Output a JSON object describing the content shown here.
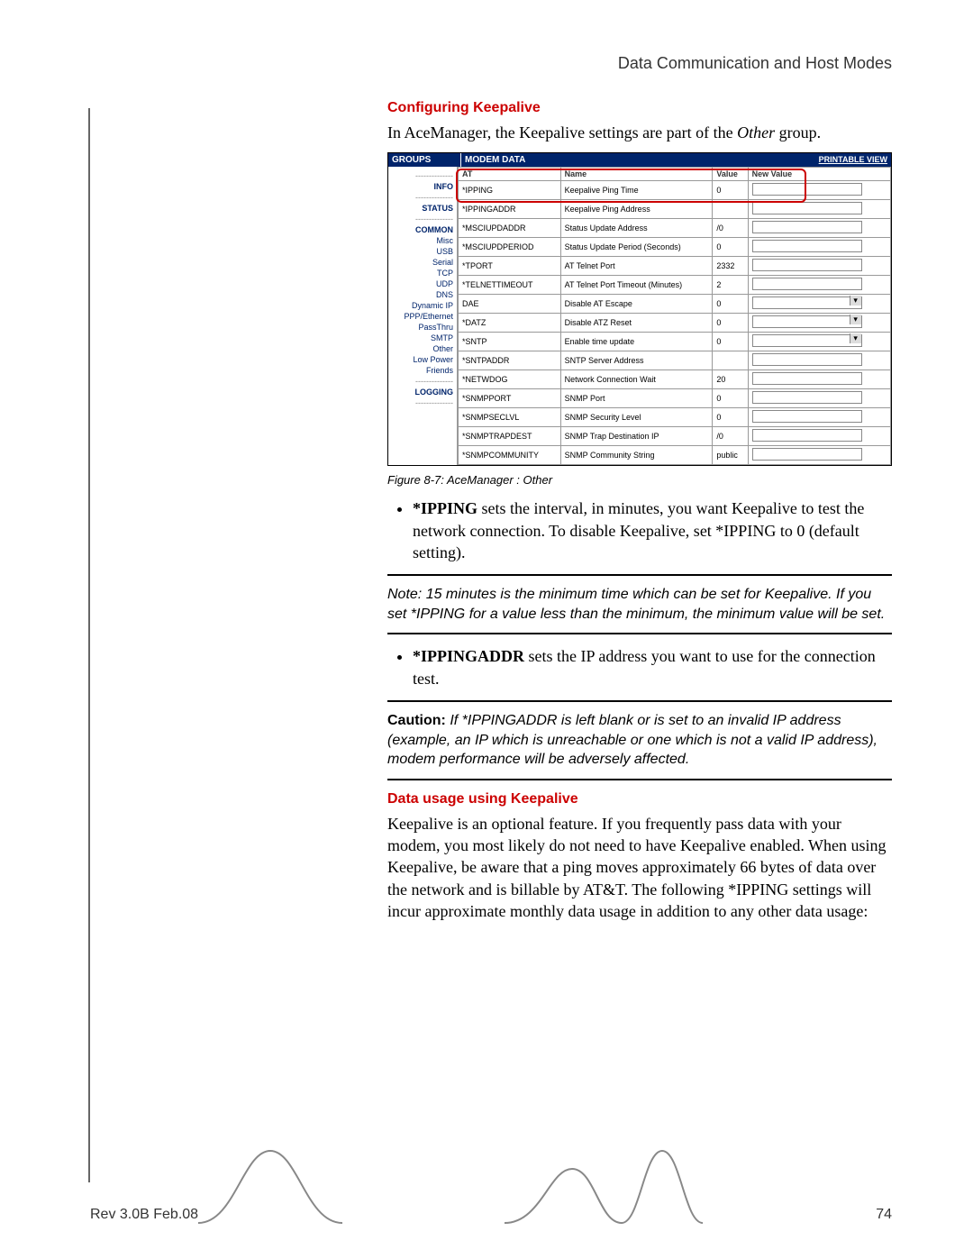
{
  "header": {
    "title": "Data Communication and Host Modes"
  },
  "section1": {
    "heading": "Configuring Keepalive",
    "intro_a": "In AceManager, the Keepalive settings are part of the ",
    "intro_b": "Other",
    "intro_c": " group."
  },
  "aceman": {
    "groups_label": "GROUPS",
    "modem_label": "MODEM DATA",
    "printable": "PRINTABLE VIEW",
    "cols": {
      "at": "AT",
      "name": "Name",
      "value": "Value",
      "new": "New Value"
    },
    "sidebar": [
      "INFO",
      "STATUS",
      "COMMON",
      "Misc",
      "USB",
      "Serial",
      "TCP",
      "UDP",
      "DNS",
      "Dynamic IP",
      "PPP/Ethernet",
      "PassThru",
      "SMTP",
      "Other",
      "Low Power",
      "Friends",
      "LOGGING"
    ],
    "rows": [
      {
        "at": "*IPPING",
        "name": "Keepalive Ping Time",
        "value": "0",
        "ctrl": "input"
      },
      {
        "at": "*IPPINGADDR",
        "name": "Keepalive Ping Address",
        "value": "",
        "ctrl": "input"
      },
      {
        "at": "*MSCIUPDADDR",
        "name": "Status Update Address",
        "value": "/0",
        "ctrl": "input"
      },
      {
        "at": "*MSCIUPDPERIOD",
        "name": "Status Update Period (Seconds)",
        "value": "0",
        "ctrl": "input"
      },
      {
        "at": "*TPORT",
        "name": "AT Telnet Port",
        "value": "2332",
        "ctrl": "input"
      },
      {
        "at": "*TELNETTIMEOUT",
        "name": "AT Telnet Port Timeout (Minutes)",
        "value": "2",
        "ctrl": "input"
      },
      {
        "at": "DAE",
        "name": "Disable AT Escape",
        "value": "0",
        "ctrl": "select"
      },
      {
        "at": "*DATZ",
        "name": "Disable ATZ Reset",
        "value": "0",
        "ctrl": "select"
      },
      {
        "at": "*SNTP",
        "name": "Enable time update",
        "value": "0",
        "ctrl": "select"
      },
      {
        "at": "*SNTPADDR",
        "name": "SNTP Server Address",
        "value": "",
        "ctrl": "input"
      },
      {
        "at": "*NETWDOG",
        "name": "Network Connection Wait",
        "value": "20",
        "ctrl": "input"
      },
      {
        "at": "*SNMPPORT",
        "name": "SNMP Port",
        "value": "0",
        "ctrl": "input"
      },
      {
        "at": "*SNMPSECLVL",
        "name": "SNMP Security Level",
        "value": "0",
        "ctrl": "input"
      },
      {
        "at": "*SNMPTRAPDEST",
        "name": "SNMP Trap Destination IP",
        "value": "/0",
        "ctrl": "input"
      },
      {
        "at": "*SNMPCOMMUNITY",
        "name": "SNMP Community String",
        "value": "public",
        "ctrl": "input"
      }
    ]
  },
  "figcap": "Figure 8-7: AceManager : Other",
  "bullet1": {
    "lead": "*IPPING",
    "rest": " sets the interval, in minutes, you want Keepalive to test the network connection. To disable Keepalive, set *IPPING to 0 (default setting)."
  },
  "note1": "Note:   15 minutes is the minimum time which can be set for Keepalive. If you set *IPPING for a value less than the minimum, the minimum value will be set.",
  "bullet2": {
    "lead": "*IPPINGADDR",
    "rest": " sets the IP address you want to use for the connection test."
  },
  "caution": {
    "lead": "Caution:",
    "rest": "  If *IPPINGADDR is left blank or is set to an invalid IP address (example, an IP which is unreachable or one which is not a valid IP address), modem performance will be adversely affected."
  },
  "section2": {
    "heading": "Data usage using Keepalive",
    "body": "Keepalive is an optional feature. If you frequently pass data with your modem, you most likely do not need to have Keepalive enabled. When using Keepalive, be aware that a ping moves approximately 66 bytes of data over the network and is billable by AT&T.  The following *IPPING settings will incur approximate monthly data usage in addition to any other data usage:"
  },
  "footer": {
    "rev": "Rev 3.0B  Feb.08",
    "page": "74"
  }
}
